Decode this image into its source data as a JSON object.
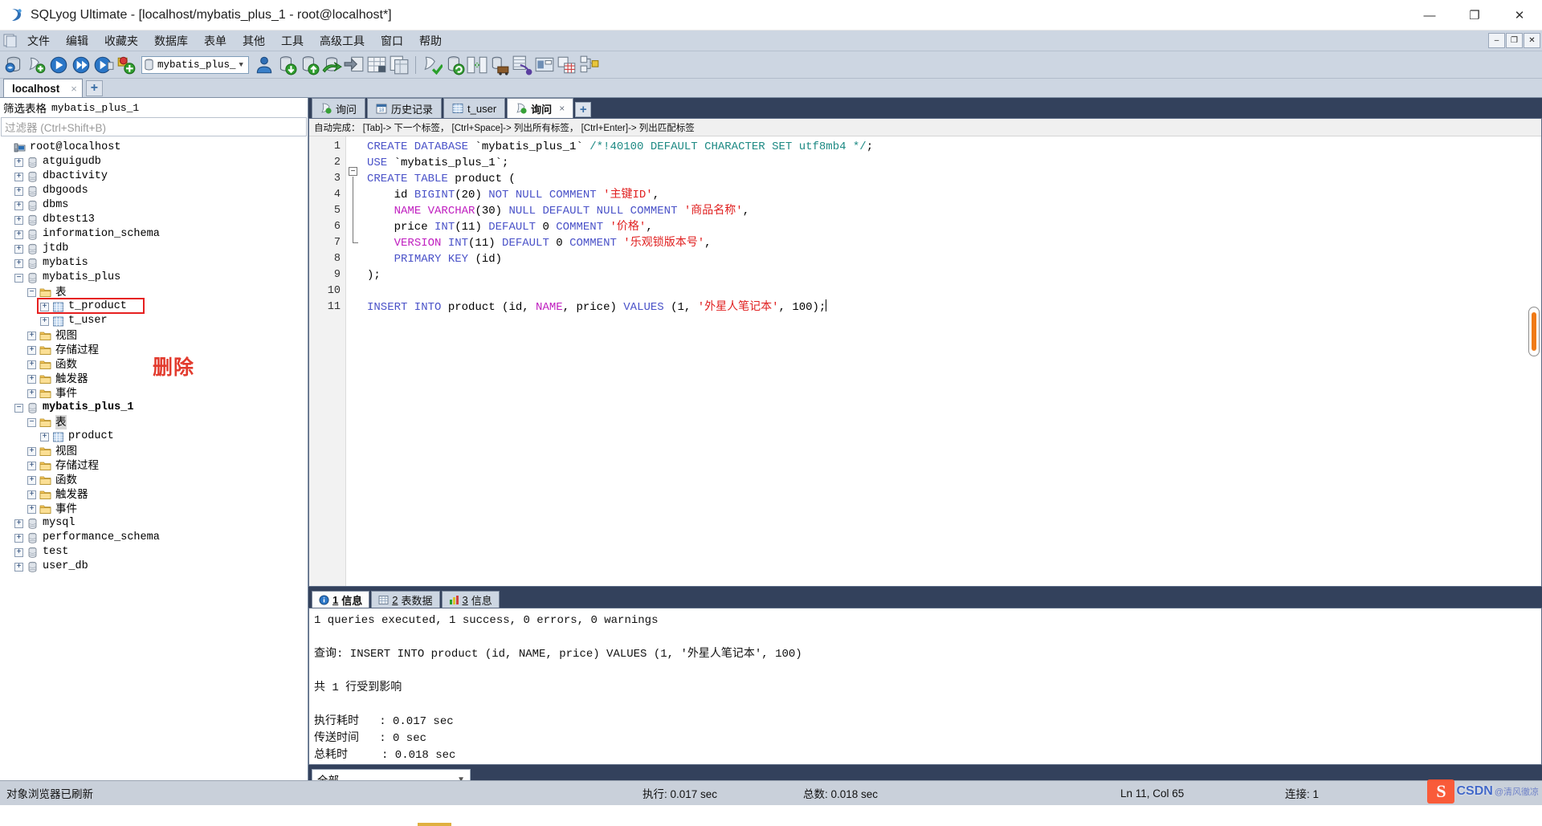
{
  "window": {
    "title": "SQLyog Ultimate - [localhost/mybatis_plus_1 - root@localhost*]",
    "app_icon": "sqlyog-icon",
    "minimize": "—",
    "maximize": "❐",
    "close": "✕",
    "mdi_minimize": "–",
    "mdi_restore": "❐",
    "mdi_close": "✕"
  },
  "menubar": {
    "items": [
      {
        "label": "文件",
        "name": "menu-file"
      },
      {
        "label": "编辑",
        "name": "menu-edit"
      },
      {
        "label": "收藏夹",
        "name": "menu-favorites"
      },
      {
        "label": "数据库",
        "name": "menu-database"
      },
      {
        "label": "表单",
        "name": "menu-table"
      },
      {
        "label": "其他",
        "name": "menu-others"
      },
      {
        "label": "工具",
        "name": "menu-tools"
      },
      {
        "label": "高级工具",
        "name": "menu-advanced-tools"
      },
      {
        "label": "窗口",
        "name": "menu-window"
      },
      {
        "label": "帮助",
        "name": "menu-help"
      }
    ]
  },
  "toolbar": {
    "db_selector_value": "mybatis_plus_",
    "icons_left": [
      "new-connection-icon",
      "new-query-icon",
      "execute-query-icon",
      "execute-all-icon",
      "execute-current-icon",
      "stop-query-icon"
    ],
    "icons_mid": [
      "user-manager-icon",
      "backup-database-icon",
      "restore-database-icon",
      "import-external-data-icon",
      "export-data-icon",
      "table-data-icon",
      "copy-table-icon"
    ],
    "icons_right": [
      "check-syntax-icon",
      "refresh-objects-icon",
      "compare-schema-icon",
      "migrate-icon",
      "schema-designer-icon",
      "query-builder-icon",
      "data-sync-icon",
      "sql-scheduler-icon"
    ]
  },
  "connection_tabs": {
    "tabs": [
      {
        "label": "localhost",
        "close": "×",
        "active": true
      }
    ],
    "add_label": "+"
  },
  "object_browser": {
    "filter_title_label": "筛选表格",
    "filter_title_db": "mybatis_plus_1",
    "filter_placeholder": "过滤器 (Ctrl+Shift+B)",
    "root": "root@localhost",
    "annotation": "删除",
    "nodes": [
      {
        "label": "root@localhost",
        "depth": 0,
        "icon": "host-icon",
        "expander": "",
        "bold": false
      },
      {
        "label": "atguigudb",
        "depth": 1,
        "icon": "db-icon",
        "expander": "+",
        "bold": false
      },
      {
        "label": "dbactivity",
        "depth": 1,
        "icon": "db-icon",
        "expander": "+",
        "bold": false
      },
      {
        "label": "dbgoods",
        "depth": 1,
        "icon": "db-icon",
        "expander": "+",
        "bold": false
      },
      {
        "label": "dbms",
        "depth": 1,
        "icon": "db-icon",
        "expander": "+",
        "bold": false
      },
      {
        "label": "dbtest13",
        "depth": 1,
        "icon": "db-icon",
        "expander": "+",
        "bold": false
      },
      {
        "label": "information_schema",
        "depth": 1,
        "icon": "db-icon",
        "expander": "+",
        "bold": false
      },
      {
        "label": "jtdb",
        "depth": 1,
        "icon": "db-icon",
        "expander": "+",
        "bold": false
      },
      {
        "label": "mybatis",
        "depth": 1,
        "icon": "db-icon",
        "expander": "+",
        "bold": false
      },
      {
        "label": "mybatis_plus",
        "depth": 1,
        "icon": "db-icon",
        "expander": "-",
        "bold": false
      },
      {
        "label": "表",
        "depth": 2,
        "icon": "folder-icon",
        "expander": "-",
        "cn": true,
        "bold": false
      },
      {
        "label": "t_product",
        "depth": 3,
        "icon": "table-icon",
        "expander": "+",
        "bold": false,
        "highlight_box": true
      },
      {
        "label": "t_user",
        "depth": 3,
        "icon": "table-icon",
        "expander": "+",
        "bold": false
      },
      {
        "label": "视图",
        "depth": 2,
        "icon": "folder-icon",
        "expander": "+",
        "cn": true,
        "bold": false
      },
      {
        "label": "存储过程",
        "depth": 2,
        "icon": "folder-icon",
        "expander": "+",
        "cn": true,
        "bold": false
      },
      {
        "label": "函数",
        "depth": 2,
        "icon": "folder-icon",
        "expander": "+",
        "cn": true,
        "bold": false
      },
      {
        "label": "触发器",
        "depth": 2,
        "icon": "folder-icon",
        "expander": "+",
        "cn": true,
        "bold": false
      },
      {
        "label": "事件",
        "depth": 2,
        "icon": "folder-icon",
        "expander": "+",
        "cn": true,
        "bold": false
      },
      {
        "label": "mybatis_plus_1",
        "depth": 1,
        "icon": "db-icon",
        "expander": "-",
        "bold": true
      },
      {
        "label": "表",
        "depth": 2,
        "icon": "folder-icon",
        "expander": "-",
        "cn": true,
        "bold": false,
        "selected": true
      },
      {
        "label": "product",
        "depth": 3,
        "icon": "table-icon",
        "expander": "+",
        "bold": false
      },
      {
        "label": "视图",
        "depth": 2,
        "icon": "folder-icon",
        "expander": "+",
        "cn": true,
        "bold": false
      },
      {
        "label": "存储过程",
        "depth": 2,
        "icon": "folder-icon",
        "expander": "+",
        "cn": true,
        "bold": false
      },
      {
        "label": "函数",
        "depth": 2,
        "icon": "folder-icon",
        "expander": "+",
        "cn": true,
        "bold": false
      },
      {
        "label": "触发器",
        "depth": 2,
        "icon": "folder-icon",
        "expander": "+",
        "cn": true,
        "bold": false
      },
      {
        "label": "事件",
        "depth": 2,
        "icon": "folder-icon",
        "expander": "+",
        "cn": true,
        "bold": false
      },
      {
        "label": "mysql",
        "depth": 1,
        "icon": "db-icon",
        "expander": "+",
        "bold": false
      },
      {
        "label": "performance_schema",
        "depth": 1,
        "icon": "db-icon",
        "expander": "+",
        "bold": false
      },
      {
        "label": "test",
        "depth": 1,
        "icon": "db-icon",
        "expander": "+",
        "bold": false
      },
      {
        "label": "user_db",
        "depth": 1,
        "icon": "db-icon",
        "expander": "+",
        "bold": false
      }
    ]
  },
  "query_tabs": {
    "tabs": [
      {
        "label": "询问",
        "icon": "query-icon",
        "active": false,
        "closable": false
      },
      {
        "label": "历史记录",
        "icon": "history-icon",
        "active": false,
        "closable": false
      },
      {
        "label": "t_user",
        "icon": "table-icon",
        "active": false,
        "closable": false
      },
      {
        "label": "询问",
        "icon": "query-icon",
        "active": true,
        "closable": true,
        "close": "×"
      }
    ],
    "add_label": "+"
  },
  "editor": {
    "autocomplete_hint": "自动完成： [Tab]-> 下一个标签， [Ctrl+Space]-> 列出所有标签， [Ctrl+Enter]-> 列出匹配标签",
    "line_numbers": [
      "1",
      "2",
      "3",
      "4",
      "5",
      "6",
      "7",
      "8",
      "9",
      "10",
      "11"
    ],
    "lines": [
      [
        {
          "t": "CREATE DATABASE ",
          "c": "kw"
        },
        {
          "t": "`mybatis_plus_1` ",
          "c": "pln"
        },
        {
          "t": "/*!40100 DEFAULT CHARACTER SET utf8mb4 */",
          "c": "cmt"
        },
        {
          "t": ";",
          "c": "pln"
        }
      ],
      [
        {
          "t": "USE ",
          "c": "kw"
        },
        {
          "t": "`mybatis_plus_1`;",
          "c": "pln"
        }
      ],
      [
        {
          "t": "CREATE TABLE ",
          "c": "kw"
        },
        {
          "t": "product (",
          "c": "pln"
        }
      ],
      [
        {
          "t": "    id ",
          "c": "pln"
        },
        {
          "t": "BIGINT",
          "c": "kw"
        },
        {
          "t": "(20) ",
          "c": "pln"
        },
        {
          "t": "NOT NULL COMMENT ",
          "c": "kw"
        },
        {
          "t": "'主键ID'",
          "c": "str"
        },
        {
          "t": ",",
          "c": "pln"
        }
      ],
      [
        {
          "t": "    ",
          "c": "pln"
        },
        {
          "t": "NAME VARCHAR",
          "c": "kw2"
        },
        {
          "t": "(30) ",
          "c": "pln"
        },
        {
          "t": "NULL DEFAULT NULL COMMENT ",
          "c": "kw"
        },
        {
          "t": "'商品名称'",
          "c": "str"
        },
        {
          "t": ",",
          "c": "pln"
        }
      ],
      [
        {
          "t": "    price ",
          "c": "pln"
        },
        {
          "t": "INT",
          "c": "kw"
        },
        {
          "t": "(11) ",
          "c": "pln"
        },
        {
          "t": "DEFAULT ",
          "c": "kw"
        },
        {
          "t": "0 ",
          "c": "pln"
        },
        {
          "t": "COMMENT ",
          "c": "kw"
        },
        {
          "t": "'价格'",
          "c": "str"
        },
        {
          "t": ",",
          "c": "pln"
        }
      ],
      [
        {
          "t": "    ",
          "c": "pln"
        },
        {
          "t": "VERSION",
          "c": "kw2"
        },
        {
          "t": " INT",
          "c": "kw"
        },
        {
          "t": "(11) ",
          "c": "pln"
        },
        {
          "t": "DEFAULT ",
          "c": "kw"
        },
        {
          "t": "0 ",
          "c": "pln"
        },
        {
          "t": "COMMENT ",
          "c": "kw"
        },
        {
          "t": "'乐观锁版本号'",
          "c": "str"
        },
        {
          "t": ",",
          "c": "pln"
        }
      ],
      [
        {
          "t": "    ",
          "c": "pln"
        },
        {
          "t": "PRIMARY KEY ",
          "c": "kw"
        },
        {
          "t": "(id)",
          "c": "pln"
        }
      ],
      [
        {
          "t": ");",
          "c": "pln"
        }
      ],
      [],
      [
        {
          "t": "INSERT INTO ",
          "c": "kw"
        },
        {
          "t": "product (id, ",
          "c": "pln"
        },
        {
          "t": "NAME",
          "c": "kw2"
        },
        {
          "t": ", price) ",
          "c": "pln"
        },
        {
          "t": "VALUES ",
          "c": "kw"
        },
        {
          "t": "(1, ",
          "c": "pln"
        },
        {
          "t": "'外星人笔记本'",
          "c": "str"
        },
        {
          "t": ", 100);",
          "c": "pln"
        }
      ]
    ]
  },
  "results": {
    "tabs": [
      {
        "num": "1",
        "label": "信息",
        "icon": "info-icon",
        "active": true
      },
      {
        "num": "2",
        "label": "表数据",
        "icon": "grid-icon",
        "active": false
      },
      {
        "num": "3",
        "label": "信息",
        "icon": "profile-icon",
        "active": false
      }
    ],
    "text_lines": [
      "1 queries executed, 1 success, 0 errors, 0 warnings",
      "",
      "查询: INSERT INTO product (id, NAME, price) VALUES (1, '外星人笔记本', 100)",
      "",
      "共 1 行受到影响",
      "",
      "执行耗时   : 0.017 sec",
      "传送时间   : 0 sec",
      "总耗时     : 0.018 sec"
    ],
    "filter_select_value": "全部"
  },
  "statusbar": {
    "message": "对象浏览器已刷新",
    "exec_time": "执行: 0.017 sec",
    "total_time": "总数: 0.018 sec",
    "cursor": "Ln 11, Col 65",
    "connections": "连接: 1",
    "watermark_brand": "CSDN",
    "watermark_author": "@清风徹凉"
  },
  "colors": {
    "chrome": "#cdd6e2",
    "dark_panel": "#33415c",
    "accent_red": "#e23b2e",
    "keyword_blue": "#4a52c8",
    "magenta": "#c020c0",
    "comment_teal": "#1e8a84",
    "string_red": "#e02020",
    "scroll_orange": "#f07a16"
  }
}
